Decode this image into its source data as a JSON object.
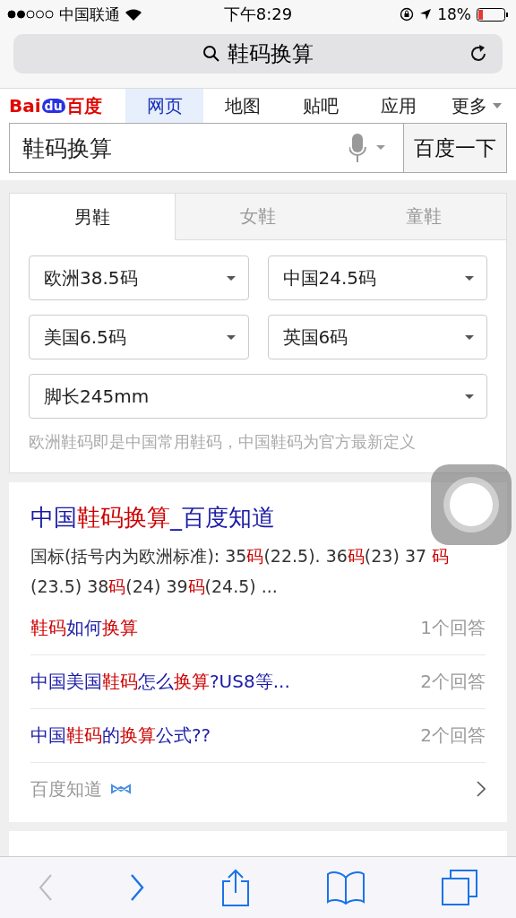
{
  "status_bar": {
    "carrier": "中国联通",
    "time": "下午8:29",
    "battery": "18%"
  },
  "address_bar": {
    "query": "鞋码换算"
  },
  "logo": {
    "part_1": "Bai",
    "part_2": "du",
    "part_3": "百度"
  },
  "nav_tabs": [
    {
      "label": "网页",
      "selected": true
    },
    {
      "label": "地图",
      "selected": false
    },
    {
      "label": "贴吧",
      "selected": false
    },
    {
      "label": "应用",
      "selected": false
    },
    {
      "label": "更多",
      "selected": false,
      "dropdown": true
    }
  ],
  "search": {
    "value": "鞋码换算",
    "button": "百度一下"
  },
  "size_card": {
    "tabs": [
      {
        "label": "男鞋",
        "selected": true
      },
      {
        "label": "女鞋",
        "selected": false
      },
      {
        "label": "童鞋",
        "selected": false
      }
    ],
    "selects": [
      {
        "value": "欧洲38.5码",
        "wide": false
      },
      {
        "value": "中国24.5码",
        "wide": false
      },
      {
        "value": "美国6.5码",
        "wide": false
      },
      {
        "value": "英国6码",
        "wide": false
      },
      {
        "value": "脚长245mm",
        "wide": true
      }
    ],
    "note": "欧洲鞋码即是中国常用鞋码，中国鞋码为官方最新定义"
  },
  "result": {
    "title": "中国**鞋码换算**_百度知道",
    "snippet": "国标(括号内为欧洲标准): 35**码**(22.5). 36**码**(23) 37 **码**(23.5) 38**码**(24) 39**码**(24.5) ...",
    "questions": [
      {
        "title": "**鞋码**如何**换算**",
        "answers": "1个回答"
      },
      {
        "title": "中国美国**鞋码**怎么**换算**?US8等...",
        "answers": "2个回答"
      },
      {
        "title": "中国**鞋码**的**换算**公式??",
        "answers": "2个回答"
      }
    ],
    "source": "百度知道"
  },
  "toolbar": [
    {
      "kind": "back",
      "disabled": true
    },
    {
      "kind": "forward",
      "disabled": false
    },
    {
      "kind": "share",
      "disabled": false
    },
    {
      "kind": "bookmarks",
      "disabled": false
    },
    {
      "kind": "tabs",
      "disabled": false
    }
  ]
}
